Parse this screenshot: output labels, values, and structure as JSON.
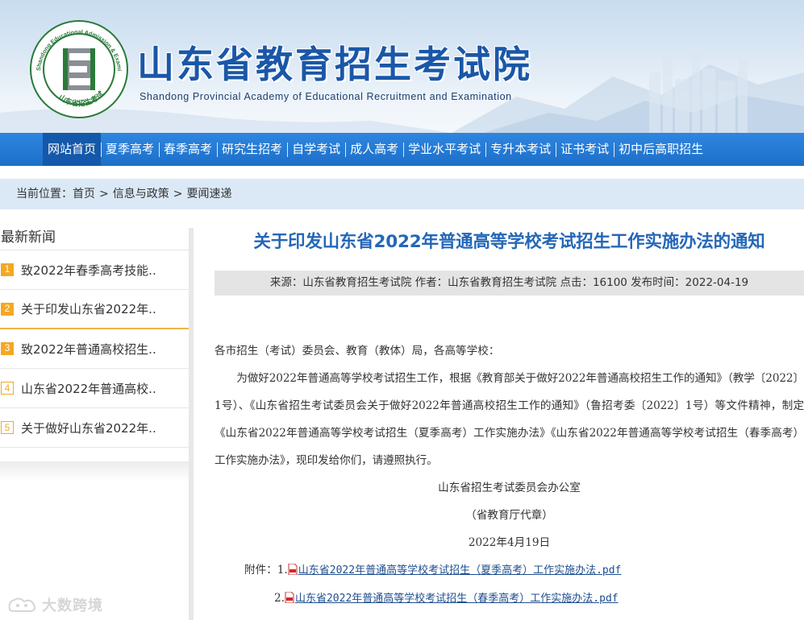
{
  "header": {
    "logo_ring_text": "Shandong Educational Admission & Examinations",
    "logo_bottom_text": "山东省招生考试",
    "title": "山东省教育招生考试院",
    "subtitle": "Shandong Provincial Academy of Educational Recruitment and Examination"
  },
  "nav": {
    "items": [
      {
        "label": "网站首页"
      },
      {
        "label": "夏季高考"
      },
      {
        "label": "春季高考"
      },
      {
        "label": "研究生招考"
      },
      {
        "label": "自学考试"
      },
      {
        "label": "成人高考"
      },
      {
        "label": "学业水平考试"
      },
      {
        "label": "专升本考试"
      },
      {
        "label": "证书考试"
      },
      {
        "label": "初中后高职招生"
      }
    ],
    "active_index": 0
  },
  "breadcrumb": {
    "prefix": "当前位置：",
    "items": [
      "首页",
      "信息与政策",
      "要闻速递"
    ],
    "separator": ">"
  },
  "sidebar": {
    "heading": "最新新闻",
    "items": [
      {
        "num": "1",
        "label": "致2022年春季高考技能.."
      },
      {
        "num": "2",
        "label": "关于印发山东省2022年.."
      },
      {
        "num": "3",
        "label": "致2022年普通高校招生.."
      },
      {
        "num": "4",
        "label": "山东省2022年普通高校.."
      },
      {
        "num": "5",
        "label": "关于做好山东省2022年.."
      }
    ]
  },
  "article": {
    "title": "关于印发山东省2022年普通高等学校考试招生工作实施办法的通知",
    "meta": "来源：山东省教育招生考试院 作者：山东省教育招生考试院 点击：16100 发布时间：2022-04-19",
    "salutation": "各市招生（考试）委员会、教育（教体）局，各高等学校：",
    "paragraph": "为做好2022年普通高等学校考试招生工作，根据《教育部关于做好2022年普通高校招生工作的通知》（教学〔2022〕1号）、《山东省招生考试委员会关于做好2022年普通高校招生工作的通知》（鲁招考委〔2022〕1号）等文件精神，制定《山东省2022年普通高等学校考试招生（夏季高考）工作实施办法》《山东省2022年普通高等学校考试招生（春季高考）工作实施办法》，现印发给你们，请遵照执行。",
    "signature_org": "山东省招生考试委员会办公室",
    "signature_note": "（省教育厅代章）",
    "signature_date": "2022年4月19日",
    "attachments_label": "附件：",
    "attachments": [
      {
        "num": "1.",
        "label": "山东省2022年普通高等学校考试招生（夏季高考）工作实施办法.pdf"
      },
      {
        "num": "2.",
        "label": "山东省2022年普通高等学校考试招生（春季高考）工作实施办法.pdf"
      }
    ]
  },
  "watermark": {
    "text": "大数跨境"
  },
  "colors": {
    "nav_bg": "#2079d6",
    "nav_active": "#1458a9",
    "title_blue": "#2467b8",
    "accent_orange": "#f3a824",
    "breadcrumb_bg": "#dbe9f6"
  }
}
